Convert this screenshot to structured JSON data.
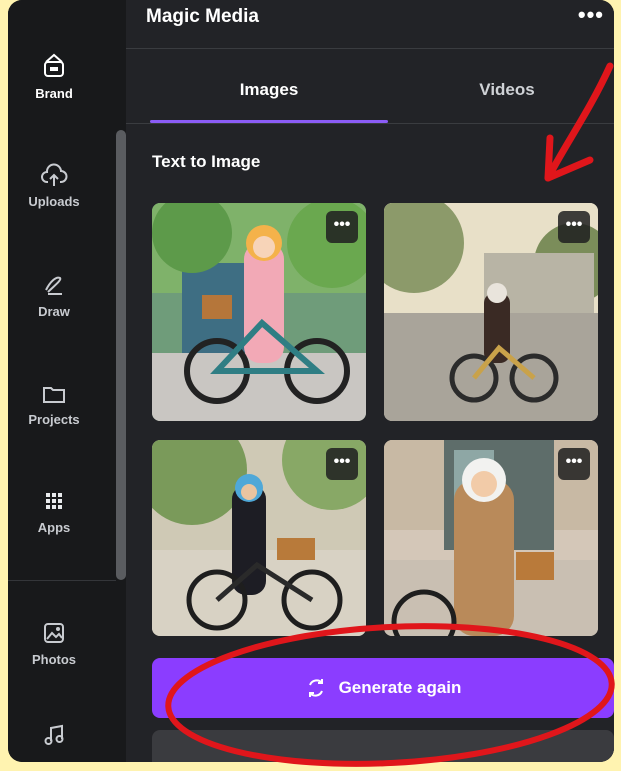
{
  "sidebar": {
    "items": [
      {
        "label": "Brand",
        "icon": "brand-icon",
        "active": true
      },
      {
        "label": "Uploads",
        "icon": "cloud-upload-icon"
      },
      {
        "label": "Draw",
        "icon": "draw-icon"
      },
      {
        "label": "Projects",
        "icon": "folder-icon"
      },
      {
        "label": "Apps",
        "icon": "apps-grid-icon"
      },
      {
        "label": "Photos",
        "icon": "photos-icon"
      },
      {
        "label": "",
        "icon": "music-note-icon"
      }
    ]
  },
  "panel": {
    "title": "Magic Media",
    "more": "•••",
    "tabs": [
      {
        "label": "Images",
        "active": true
      },
      {
        "label": "Videos",
        "active": false
      }
    ],
    "section_title": "Text to Image",
    "thumbnails": [
      {
        "name": "woman-bike-cartoon-1",
        "more": "•••"
      },
      {
        "name": "woman-bike-photo-2",
        "more": "•••"
      },
      {
        "name": "woman-bike-cartoon-3",
        "more": "•••"
      },
      {
        "name": "woman-bike-cartoon-4",
        "more": "•••"
      }
    ],
    "generate_button": "Generate again"
  },
  "colors": {
    "accent": "#8b3dff",
    "annotation": "#e0161b",
    "background": "#fff3b0"
  }
}
